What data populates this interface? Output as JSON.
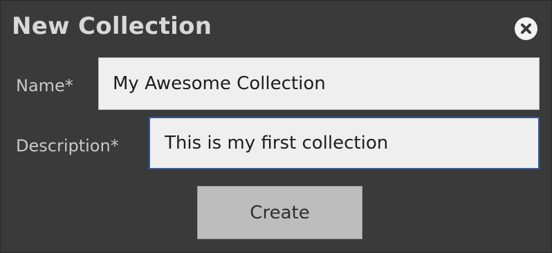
{
  "dialog": {
    "title": "New Collection",
    "close_icon": "close-icon"
  },
  "form": {
    "name_label": "Name*",
    "name_value": "My Awesome Collection",
    "description_label": "Description*",
    "description_value": "This is my first collection"
  },
  "actions": {
    "create_label": "Create"
  },
  "colors": {
    "dialog_background": "#3a3a3a",
    "input_background": "#efefef",
    "focused_border": "#2d5c96",
    "button_background": "#bdbdbd"
  }
}
